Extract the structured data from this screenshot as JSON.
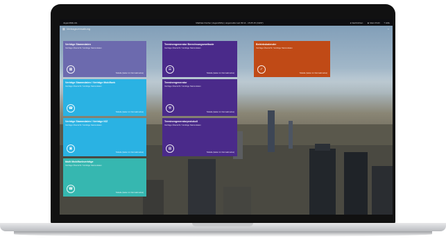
{
  "topbar": {
    "app_name": "Jugendhilfe AG",
    "user_line": "Matthias Fischer (Jugendhilfe) | angemeldet seit 09:14 - 15.05.15 (CEST)",
    "messages": "Nachrichten",
    "profile": "Mein Profil",
    "help": "Hilfe"
  },
  "breadcrumb": {
    "label": "Vertragsverwaltung"
  },
  "tiles": [
    {
      "title": "Verträge Stammdaten",
      "subtitle": "Verträge Übersicht / Verträge Stammdaten",
      "footer": "Tabelle (laden im Normalmodus)",
      "icon": "calendar-icon"
    },
    {
      "title": "Terminengenerator Berechnungsmethode",
      "subtitle": "Verträge Übersicht / Verträge Stammdaten",
      "footer": "Tabelle (laden im Normalmodus)",
      "icon": "list-icon"
    },
    {
      "title": "Betriebskalender",
      "subtitle": "Verträge Übersicht / Verträge Stammdaten",
      "footer": "Tabelle (laden im Normalmodus)",
      "icon": "calendar-check-icon"
    },
    {
      "title": "Verträge Stammdaten / Verträge Mobilfunk",
      "subtitle": "Verträge Übersicht / Verträge Stammdaten",
      "footer": "Tabelle (laden im Normalmodus)",
      "icon": "phone-icon"
    },
    {
      "title": "Terminengenerator",
      "subtitle": "Verträge Übersicht / Verträge Stammdaten",
      "footer": "Tabelle (laden im Normalmodus)",
      "icon": "wrench-icon"
    },
    {
      "title": "Verträge Stammdaten / Verträge KfZ",
      "subtitle": "Verträge Übersicht / Verträge Stammdaten",
      "footer": "Tabelle (laden im Normalmodus)",
      "icon": "car-icon"
    },
    {
      "title": "Terminengeneratorprotokoll",
      "subtitle": "Verträge Übersicht / Verträge Stammdaten",
      "footer": "Tabelle (laden im Normalmodus)",
      "icon": "document-icon"
    },
    {
      "title": "Multi Mobilfunkverträge",
      "subtitle": "Verträge Übersicht / Verträge Stammdaten",
      "footer": "Tabelle (laden im Normalmodus)",
      "icon": "phone-icon"
    }
  ]
}
